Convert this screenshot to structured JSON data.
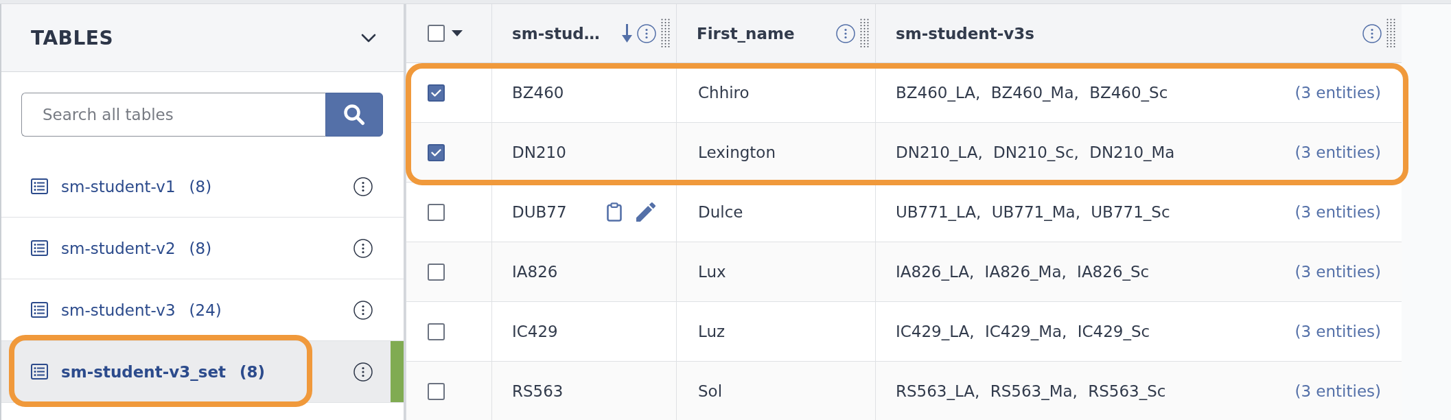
{
  "sidebar": {
    "title": "TABLES",
    "expanded": true,
    "search": {
      "placeholder": "Search all tables"
    },
    "items": [
      {
        "name": "sm-student-v1",
        "count": "(8)",
        "selected": false,
        "highlighted": false
      },
      {
        "name": "sm-student-v2",
        "count": "(8)",
        "selected": false,
        "highlighted": false
      },
      {
        "name": "sm-student-v3",
        "count": "(24)",
        "selected": false,
        "highlighted": false
      },
      {
        "name": "sm-student-v3_set",
        "count": "(8)",
        "selected": true,
        "highlighted": true
      }
    ]
  },
  "table": {
    "select_all": {
      "checked": false
    },
    "columns": [
      {
        "label": "sm-stud…",
        "sorted": true
      },
      {
        "label": "First_name",
        "sorted": false
      },
      {
        "label": "sm-student-v3s",
        "sorted": false
      }
    ],
    "rows": [
      {
        "checked": true,
        "highlighted": true,
        "hovered": false,
        "column_1": "BZ460",
        "first_name": "Chhiro",
        "sm_student_v3s": "BZ460_LA, BZ460_Ma, BZ460_Sc",
        "entity_count": "(3 entities)"
      },
      {
        "checked": true,
        "highlighted": true,
        "hovered": false,
        "column_1": "DN210",
        "first_name": "Lexington",
        "sm_student_v3s": "DN210_LA, DN210_Sc, DN210_Ma",
        "entity_count": "(3 entities)"
      },
      {
        "checked": false,
        "highlighted": false,
        "hovered": true,
        "column_1": "DUB77",
        "first_name": "Dulce",
        "sm_student_v3s": "UB771_LA, UB771_Ma, UB771_Sc",
        "entity_count": "(3 entities)"
      },
      {
        "checked": false,
        "highlighted": false,
        "hovered": false,
        "column_1": "IA826",
        "first_name": "Lux",
        "sm_student_v3s": "IA826_LA, IA826_Ma, IA826_Sc",
        "entity_count": "(3 entities)"
      },
      {
        "checked": false,
        "highlighted": false,
        "hovered": false,
        "column_1": "IC429",
        "first_name": "Luz",
        "sm_student_v3s": "IC429_LA, IC429_Ma, IC429_Sc",
        "entity_count": "(3 entities)"
      },
      {
        "checked": false,
        "highlighted": false,
        "hovered": false,
        "column_1": "RS563",
        "first_name": "Sol",
        "sm_student_v3s": "RS563_LA, RS563_Ma, RS563_Sc",
        "entity_count": "(3 entities)"
      }
    ]
  }
}
